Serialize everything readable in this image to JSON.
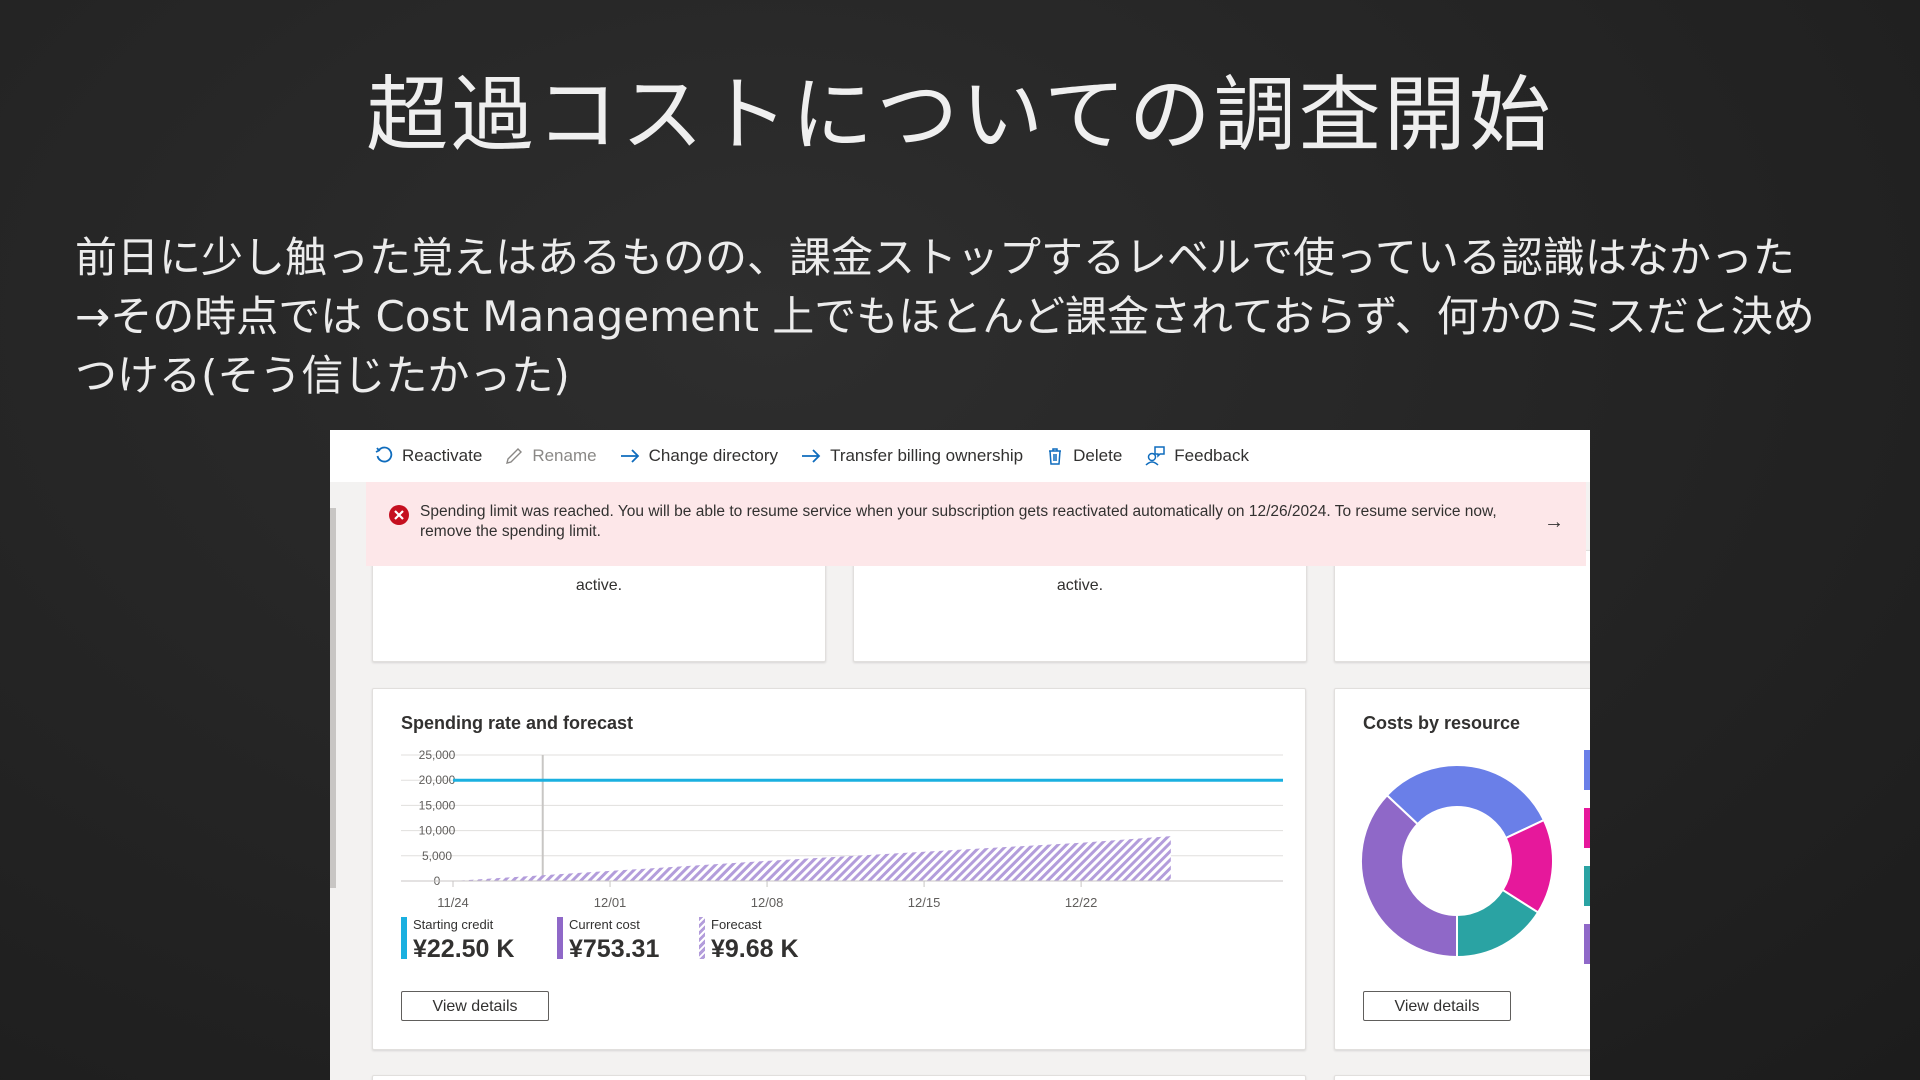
{
  "slide": {
    "title": "超過コストについての調査開始",
    "body_lines": [
      "前日に少し触った覚えはあるものの、課金ストップするレベルで使っている認識はなかった",
      "→その時点では Cost Management 上でもほとんど課金されておらず、何かのミスだと決め",
      "つける(そう信じたかった)"
    ]
  },
  "toolbar": {
    "items": [
      {
        "label": "Reactivate",
        "icon": "refresh-icon",
        "enabled": true
      },
      {
        "label": "Rename",
        "icon": "pencil-icon",
        "enabled": false
      },
      {
        "label": "Change directory",
        "icon": "arrow-right-icon",
        "enabled": true
      },
      {
        "label": "Transfer billing ownership",
        "icon": "arrow-right-icon",
        "enabled": true
      },
      {
        "label": "Delete",
        "icon": "trash-icon",
        "enabled": true
      },
      {
        "label": "Feedback",
        "icon": "feedback-icon",
        "enabled": true
      }
    ]
  },
  "alert": {
    "icon": "error-circle-icon",
    "message": "Spending limit was reached. You will be able to resume service when your subscription gets reactivated automatically on 12/26/2024. To resume service now, remove the spending limit.",
    "action_icon": "arrow-right-icon"
  },
  "top_cards": [
    {
      "text": "active."
    },
    {
      "text": "active."
    },
    {
      "text": ""
    }
  ],
  "spending_card": {
    "title": "Spending rate and forecast",
    "legend": [
      {
        "label": "Starting credit",
        "value": "¥22.50 K",
        "color": "#1ab0e0"
      },
      {
        "label": "Current cost",
        "value": "¥753.31",
        "color": "#8f68c8"
      },
      {
        "label": "Forecast",
        "value": "¥9.68 K",
        "color": "#b39ddb"
      }
    ],
    "button": "View details"
  },
  "resource_card": {
    "title": "Costs by resource",
    "button": "View details"
  },
  "chart_data": [
    {
      "type": "area",
      "title": "Spending rate and forecast",
      "y_ticks": [
        "0",
        "5,000",
        "10,000",
        "15,000",
        "20,000",
        "25,000"
      ],
      "ylim": [
        0,
        25000
      ],
      "x_ticks": [
        "11/24",
        "12/01",
        "12/08",
        "12/15",
        "12/22"
      ],
      "x_range": [
        "11/24",
        "12/31"
      ],
      "grid": true,
      "series": [
        {
          "name": "Starting credit",
          "kind": "line",
          "color": "#1ab0e0",
          "x": [
            "11/24",
            "12/31"
          ],
          "y": [
            20000,
            20000
          ]
        },
        {
          "name": "Forecast",
          "kind": "area-hatched",
          "color": "#b39ddb",
          "x": [
            "11/24",
            "12/01",
            "12/08",
            "12/15",
            "12/22",
            "12/26"
          ],
          "y": [
            0,
            2000,
            4000,
            5800,
            7600,
            8900
          ]
        }
      ],
      "today_marker": "11/28"
    },
    {
      "type": "pie",
      "title": "Costs by resource",
      "donut": true,
      "values": [
        37,
        31,
        16,
        16
      ],
      "colors": [
        "#8f68c8",
        "#6a7fe8",
        "#e6189b",
        "#2aa3a3"
      ]
    }
  ]
}
